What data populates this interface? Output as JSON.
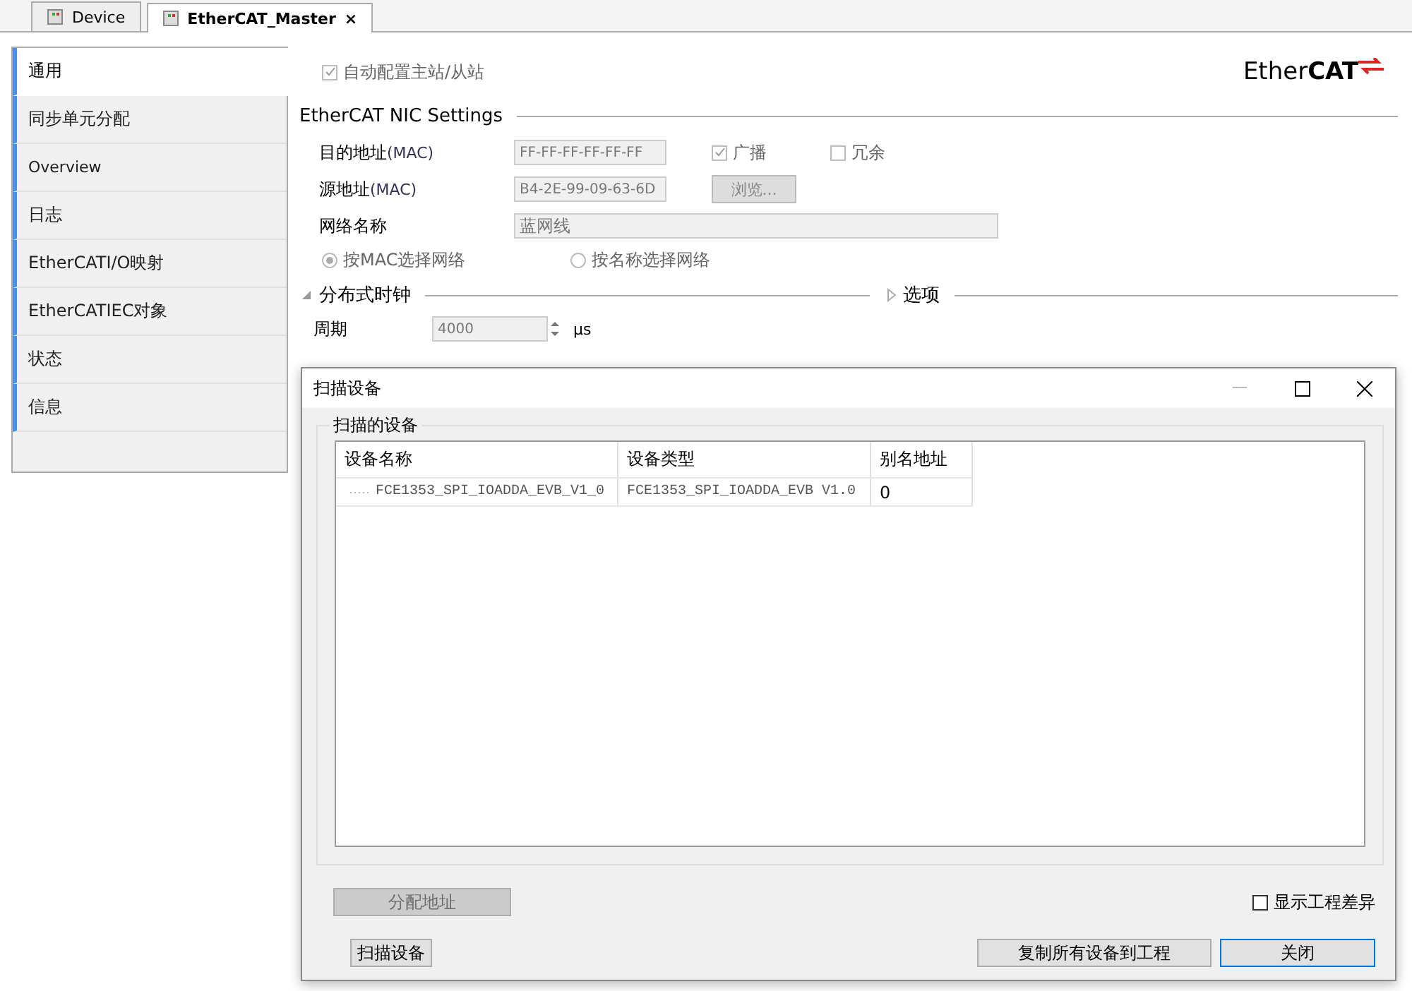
{
  "tabs": [
    {
      "label": "Device",
      "selected": false
    },
    {
      "label": "EtherCAT_Master",
      "selected": true,
      "close": "×"
    }
  ],
  "sidebar": {
    "items": [
      {
        "label": "通用",
        "selected": true
      },
      {
        "label": "同步单元分配",
        "selected": false
      },
      {
        "label": "Overview",
        "selected": false
      },
      {
        "label": "日志",
        "selected": false
      },
      {
        "label": "EtherCATI/O映射",
        "selected": false
      },
      {
        "label": "EtherCATIEC对象",
        "selected": false
      },
      {
        "label": "状态",
        "selected": false
      },
      {
        "label": "信息",
        "selected": false
      }
    ]
  },
  "general": {
    "auto_config": {
      "label": "自动配置主站/从站",
      "checked": true,
      "disabled": true
    },
    "logo": {
      "ether": "Ether",
      "cat": "CAT"
    },
    "nic_title": "EtherCAT NIC Settings",
    "dest_label": "目的地址",
    "dest_unit": "(MAC)",
    "dest_value": "FF-FF-FF-FF-FF-FF",
    "broadcast": {
      "label": "广播",
      "checked": true
    },
    "redundant": {
      "label": "冗余",
      "checked": false
    },
    "src_label": "源地址",
    "src_unit": "(MAC)",
    "src_value": "B4-2E-99-09-63-6D",
    "browse": "浏览...",
    "net_label": "网络名称",
    "net_value": "蓝网线",
    "radios": [
      {
        "label": "按MAC选择网络",
        "selected": true
      },
      {
        "label": "按名称选择网络",
        "selected": false
      }
    ],
    "dc": {
      "label": "分布式时钟",
      "expanded": true
    },
    "options": {
      "label": "选项",
      "expanded": false
    },
    "period_label": "周期",
    "period_value": "4000",
    "period_unit": "µs"
  },
  "dialog": {
    "title": "扫描设备",
    "group": "扫描的设备",
    "columns": [
      "设备名称",
      "设备类型",
      "别名地址"
    ],
    "rows": [
      [
        "FCE1353_SPI_IOADDA_EVB_V1_0",
        "FCE1353_SPI_IOADDA_EVB V1.0",
        "0"
      ]
    ],
    "assign": {
      "label": "分配地址",
      "disabled": true
    },
    "show_diff": {
      "label": "显示工程差异",
      "checked": false
    },
    "scan": "扫描设备",
    "copy_all": "复制所有设备到工程",
    "close": "关闭"
  }
}
